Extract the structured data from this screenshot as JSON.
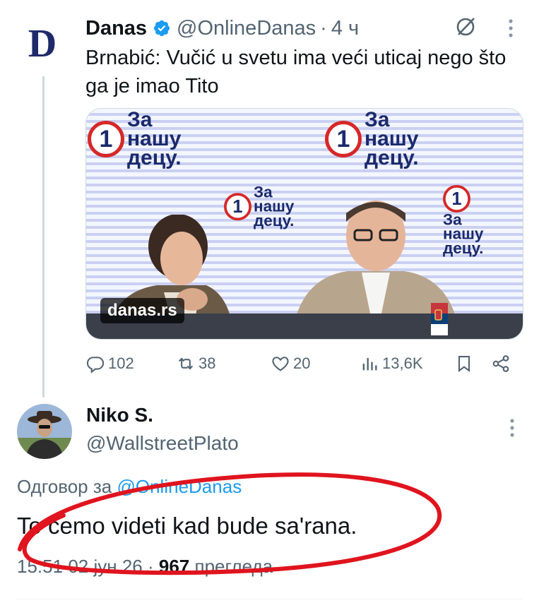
{
  "parent": {
    "avatar_letter": "D",
    "name": "Danas",
    "handle": "@OnlineDanas",
    "dot": "·",
    "time": "4 ч",
    "text": "Brnabić: Vučić u svetu ima veći uticaj nego što ga je imao Tito",
    "media": {
      "badge": "danas.rs",
      "poster_number": "1",
      "poster_text_line1": "За",
      "poster_text_line2": "нашу",
      "poster_text_line3": "децу."
    },
    "actions": {
      "replies": "102",
      "reposts": "38",
      "likes": "20",
      "views": "13,6K"
    }
  },
  "reply": {
    "name": "Niko S.",
    "handle": "@WallstreetPlato",
    "reply_prefix": "Одговор за",
    "reply_to": "@OnlineDanas",
    "text": "To ćemo videti kad bude sa'rana.",
    "time": "15:51",
    "date": "02 јун 26",
    "dot": "·",
    "views_count": "967",
    "views_label": "прегледа"
  },
  "colors": {
    "accent": "#1d9bf0",
    "muted": "#536471",
    "annotation": "#e0141e"
  }
}
